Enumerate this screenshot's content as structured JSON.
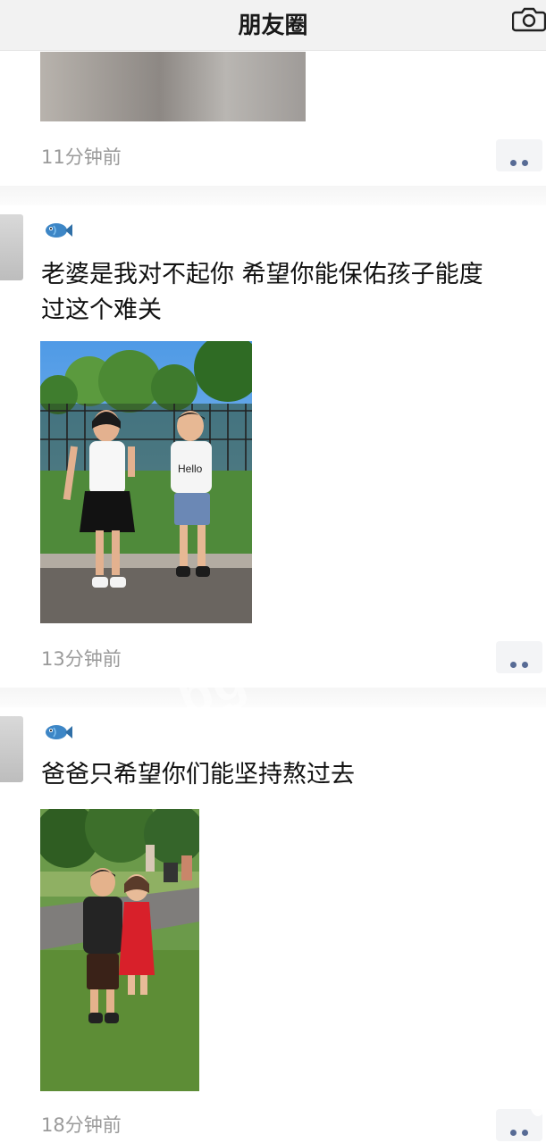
{
  "header": {
    "title": "朋友圈",
    "camera_icon": "camera-icon"
  },
  "posts": [
    {
      "time": "11分钟前",
      "more_icon": "more-dots-icon"
    },
    {
      "badge_icon": "fish-icon",
      "text_lines": [
        "老婆是我对不起你  希望你能保佑孩子能度",
        "过这个难关"
      ],
      "photo_shirt_text": "Hello",
      "time": "13分钟前",
      "more_icon": "more-dots-icon"
    },
    {
      "badge_icon": "fish-icon",
      "text_lines": [
        "爸爸只希望你们能坚持熬过去"
      ],
      "time": "18分钟前",
      "more_icon": "more-dots-icon"
    }
  ],
  "watermark": "bg88",
  "colors": {
    "link_blue": "#576b95",
    "time_gray": "#9a9a9a",
    "header_bg": "#f2f2f2"
  }
}
